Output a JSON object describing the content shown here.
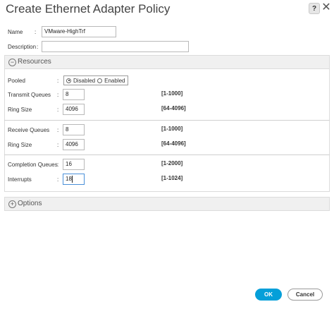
{
  "dialog": {
    "title": "Create Ethernet Adapter Policy"
  },
  "header_icons": {
    "help": "help-icon",
    "close": "close-icon"
  },
  "form": {
    "name_label": "Name",
    "name_value": "VMware-HighTrf",
    "description_label": "Description",
    "description_value": ""
  },
  "resources": {
    "title": "Resources",
    "pooled_label": "Pooled",
    "pooled_options": [
      "Disabled",
      "Enabled"
    ],
    "pooled_selected": "Disabled",
    "rows": [
      {
        "label": "Transmit Queues",
        "value": "8",
        "range": "[1-1000]"
      },
      {
        "label": "Ring Size",
        "value": "4096",
        "range": "[64-4096]"
      },
      {
        "label": "Receive Queues",
        "value": "8",
        "range": "[1-1000]"
      },
      {
        "label": "Ring Size",
        "value": "4096",
        "range": "[64-4096]"
      },
      {
        "label": "Completion Queues",
        "value": "16",
        "range": "[1-2000]"
      },
      {
        "label": "Interrupts",
        "value": "18",
        "range": "[1-1024]"
      }
    ]
  },
  "options": {
    "title": "Options"
  },
  "footer": {
    "ok_label": "OK",
    "cancel_label": "Cancel"
  },
  "colors": {
    "primary": "#049fd9",
    "section_bg": "#f0f0f0"
  }
}
